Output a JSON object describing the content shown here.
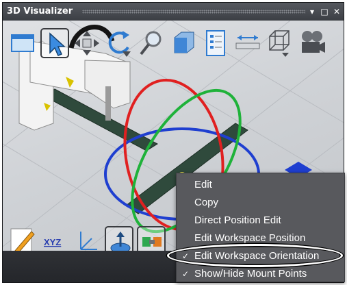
{
  "window": {
    "title": "3D Visualizer"
  },
  "title_buttons": [
    {
      "name": "dropdown-arrow-icon",
      "glyph": "▾"
    },
    {
      "name": "maximize-icon",
      "glyph": "□"
    },
    {
      "name": "close-icon",
      "glyph": "✕"
    }
  ],
  "toolbar": {
    "items": [
      {
        "name": "window-icon",
        "active": false
      },
      {
        "name": "select-arrow-icon",
        "active": true
      },
      {
        "name": "pan-move-icon",
        "active": false
      },
      {
        "name": "rotate-view-icon",
        "active": false
      },
      {
        "name": "zoom-magnifier-icon",
        "active": false
      },
      {
        "name": "cube-view-icon",
        "active": false
      },
      {
        "name": "object-list-icon",
        "active": false
      },
      {
        "name": "measure-ruler-icon",
        "active": false
      },
      {
        "name": "wireframe-box-icon",
        "active": false
      },
      {
        "name": "video-camera-icon",
        "active": false
      }
    ]
  },
  "bottom_toolbar": {
    "xyz_label": "XYZ",
    "items": [
      {
        "name": "edit-pencil-icon"
      },
      {
        "name": "xyz-coordinates-icon"
      },
      {
        "name": "axes-icon"
      },
      {
        "name": "mount-point-icon"
      },
      {
        "name": "connector-icon"
      }
    ]
  },
  "context_menu": {
    "items": [
      {
        "label": "Edit",
        "checked": false
      },
      {
        "label": "Copy",
        "checked": false
      },
      {
        "label": "Direct Position Edit",
        "checked": false
      },
      {
        "label": "Edit Workspace Position",
        "checked": false
      },
      {
        "label": "Edit Workspace Orientation",
        "checked": true,
        "highlighted": true
      },
      {
        "label": "Show/Hide Mount Points",
        "checked": true
      }
    ],
    "check_glyph": "✓"
  },
  "colors": {
    "ring_red": "#e02020",
    "ring_green": "#1fb23a",
    "ring_blue": "#1f3fd0",
    "conveyor": "#2f4a3c",
    "menu_bg": "#58595d"
  }
}
